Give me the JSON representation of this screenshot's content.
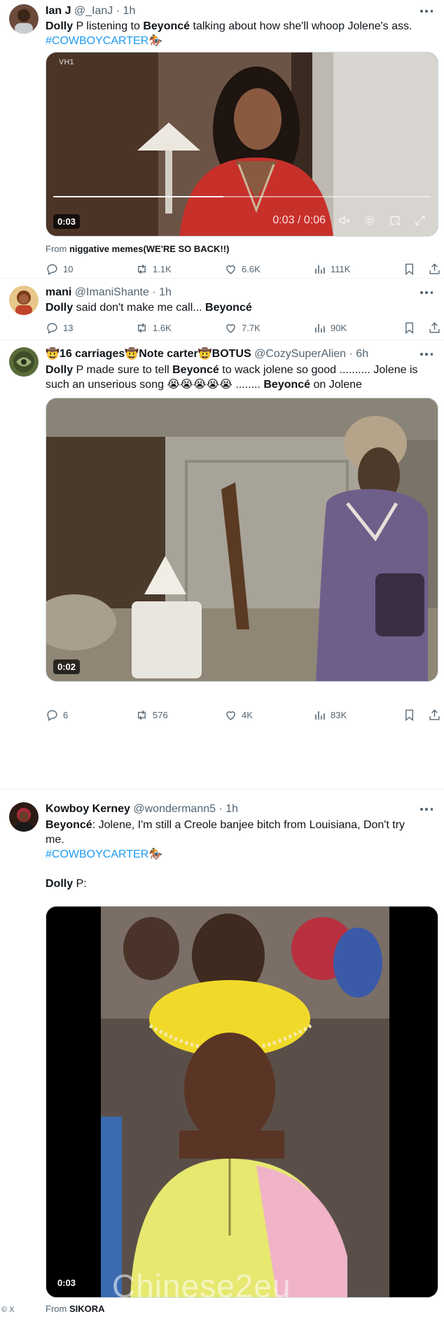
{
  "tweets": [
    {
      "name": "Ian J",
      "handle": "@_IanJ",
      "time": "1h",
      "text_parts": [
        "Dolly",
        " P listening to ",
        "Beyoncé",
        " talking about how she'll whoop Jolene's ass."
      ],
      "hashtag": "#COWBOYCARTER",
      "media": {
        "timer": "0:03",
        "overlay_time": "0:03 / 0:06",
        "watermark": "VH1"
      },
      "from_label": "From",
      "from_source": "niggative memes(WE'RE SO BACK!!)",
      "stats": {
        "replies": "10",
        "retweets": "1.1K",
        "likes": "6.6K",
        "views": "111K"
      }
    },
    {
      "name": "mani",
      "handle": "@ImaniShante",
      "time": "1h",
      "text_parts": [
        "Dolly",
        " said don't make me call... ",
        "Beyoncé"
      ],
      "stats": {
        "replies": "13",
        "retweets": "1.6K",
        "likes": "7.7K",
        "views": "90K"
      }
    },
    {
      "name": "🤠16 carriages🤠Note carter🤠BOTUS",
      "handle": "@CozySuperAlien",
      "time": "6h",
      "text_line1": [
        "Dolly",
        " P  made sure to tell ",
        "Beyoncé",
        " to wack jolene so good .......... Jolene is"
      ],
      "text_line2": [
        "such an unserious song 😭😭😭😭😭 ........ ",
        "Beyoncé",
        " on Jolene"
      ],
      "media": {
        "timer": "0:02"
      },
      "stats": {
        "replies": "6",
        "retweets": "576",
        "likes": "4K",
        "views": "83K"
      }
    },
    {
      "name": "Kowboy Kerney",
      "handle": "@wondermann5",
      "time": "1h",
      "text_line1": [
        "Beyoncé",
        ": Jolene, I'm still a Creole banjee bitch from Louisiana, Don't try"
      ],
      "text_line2": "me.",
      "hashtag": "#COWBOYCARTER",
      "text_line3": [
        "Dolly",
        " P:"
      ],
      "media": {
        "timer": "0:03"
      },
      "from_label": "From",
      "from_source": "SIKORA"
    }
  ],
  "ui": {
    "dot": "·",
    "x_mark": "© X",
    "watermark_text": "Chinese2eu"
  },
  "colors": {
    "accent": "#1d9bf0",
    "muted": "#536471",
    "text": "#0f1419"
  },
  "icons": [
    "reply-icon",
    "retweet-icon",
    "like-icon",
    "views-icon",
    "bookmark-icon",
    "share-icon",
    "more-icon",
    "volume-icon",
    "settings-icon",
    "pip-icon",
    "fullscreen-icon",
    "horse-emoji-icon"
  ]
}
